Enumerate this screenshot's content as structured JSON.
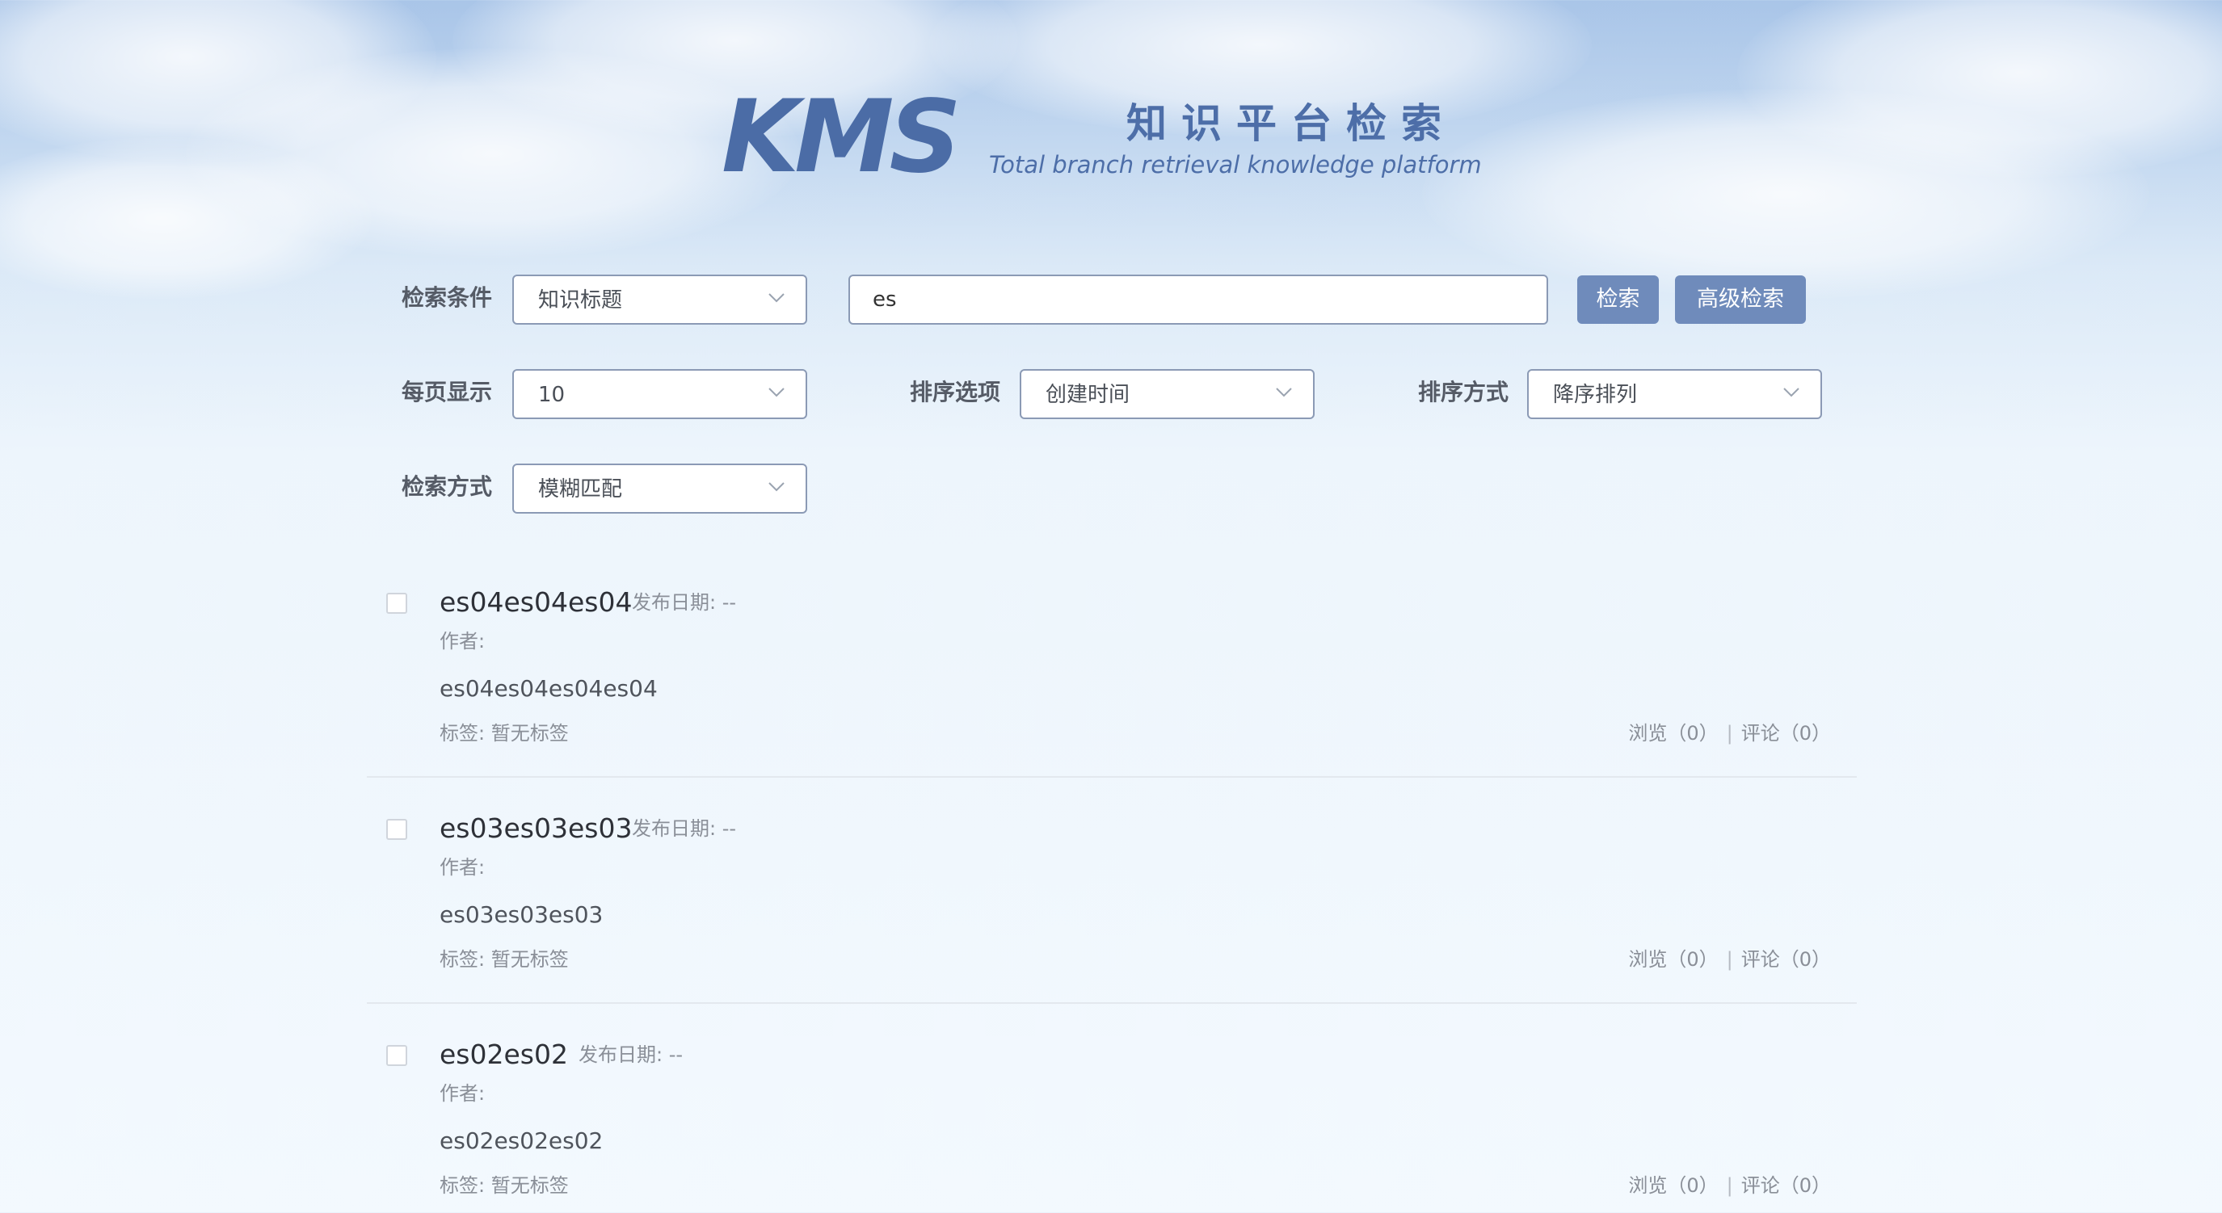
{
  "header": {
    "logo": "KMS",
    "title": "知识平台检索",
    "subtitle": "Total branch retrieval knowledge platform"
  },
  "search": {
    "condition_label": "检索条件",
    "condition_value": "知识标题",
    "query_value": "es",
    "search_button": "检索",
    "advanced_button": "高级检索"
  },
  "options": {
    "page_size_label": "每页显示",
    "page_size_value": "10",
    "sort_field_label": "排序选项",
    "sort_field_value": "创建时间",
    "sort_order_label": "排序方式",
    "sort_order_value": "降序排列",
    "match_label": "检索方式",
    "match_value": "模糊匹配"
  },
  "results": [
    {
      "title": "es04es04es04",
      "date": "发布日期: --",
      "author": "作者:",
      "summary": "es04es04es04es04",
      "tags": "标签: 暂无标签",
      "views": "浏览（0）",
      "comments": "评论（0）"
    },
    {
      "title": "es03es03es03",
      "date": "发布日期: --",
      "author": "作者:",
      "summary": "es03es03es03",
      "tags": "标签: 暂无标签",
      "views": "浏览（0）",
      "comments": "评论（0）"
    },
    {
      "title": "es02es02",
      "date": "发布日期: --",
      "author": "作者:",
      "summary": "es02es02es02",
      "tags": "标签: 暂无标签",
      "views": "浏览（0）",
      "comments": "评论（0）"
    }
  ],
  "stats_separator": "|",
  "icons": {
    "dropdown": "chevron-down-icon"
  },
  "colors": {
    "brand": "#4b6ca6",
    "button": "#6f8bbb",
    "sky": "#a9c5e8"
  }
}
